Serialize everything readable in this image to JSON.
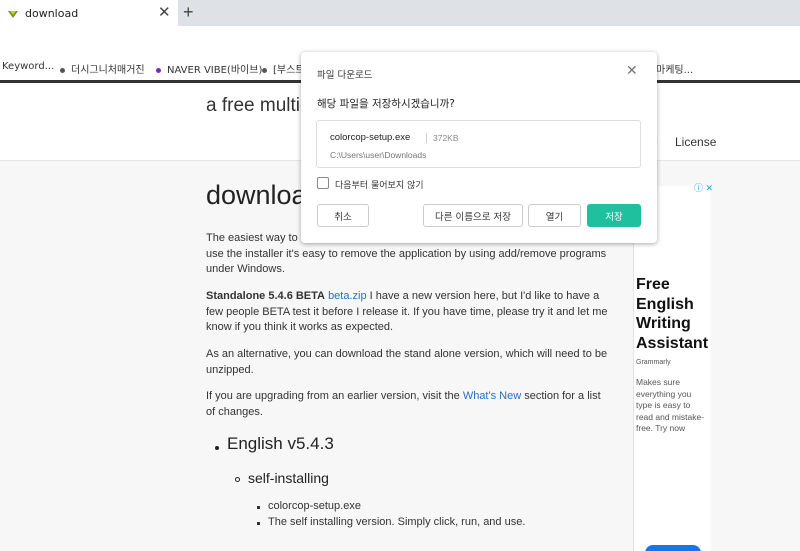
{
  "browser": {
    "tab_title": "download",
    "bookmarks": [
      "Keyword...",
      "더시그니처매거진",
      "NAVER VIBE(바이브)",
      "[부스트...",
      "마케팅..."
    ]
  },
  "site": {
    "tagline": "a free multi-p",
    "nav_partial": "e",
    "nav_license": "License"
  },
  "main": {
    "heading": "downloa",
    "intro_line1": "The easiest way to",
    "intro_rest": "use the installer it's easy to remove the application by using add/remove programs under Windows.",
    "beta_label": "Standalone 5.4.6 BETA",
    "beta_link": "beta.zip",
    "beta_text": "I have a new version here, but I'd like to have a few people BETA test it before I release it. If you have time, please try it and let me know if you think it works as expected.",
    "alt_text": "As an alternative, you can download the stand alone version, which will need to be unzipped.",
    "upgrade_pre": "If you are upgrading from an earlier version, visit the",
    "upgrade_link": "What's New",
    "upgrade_post": "section for a list of changes.",
    "english_heading": "English v5.4.3",
    "self_installing": "self-installing",
    "setup_link": "colorcop-setup.exe",
    "setup_desc": "The self installing version. Simply click, run, and use."
  },
  "ad": {
    "title": "Free English Writing Assistant",
    "brand": "Grammarly",
    "body": "Makes sure everything you type is easy to read and mistake-free. Try now"
  },
  "dialog": {
    "title": "파일 다운로드",
    "question": "해당 파일을 저장하시겠습니까?",
    "file_name": "colorcop-setup.exe",
    "file_size": "372KB",
    "file_path": "C:\\Users\\user\\Downloads",
    "checkbox_label": "다음부터 물어보지 않기",
    "checkbox_checked": false,
    "cancel_label": "취소",
    "save_as_label": "다른 이름으로 저장",
    "open_label": "열기",
    "save_label": "저장",
    "accent_color": "#1fc09e"
  }
}
